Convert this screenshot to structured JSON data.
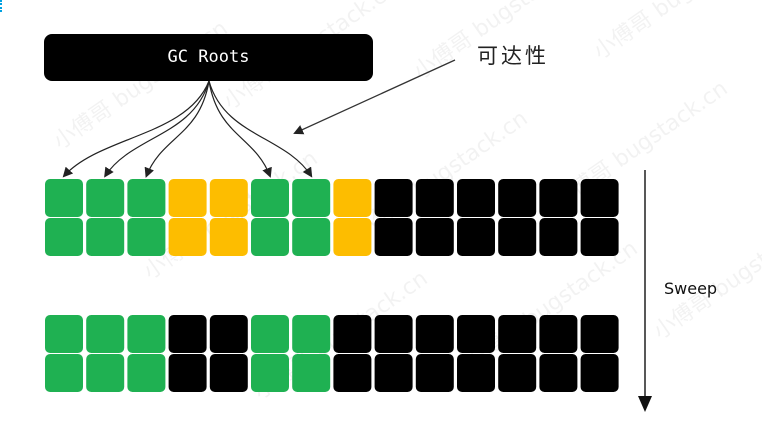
{
  "gc_roots_label": "GC Roots",
  "reachability_label": "可达性",
  "sweep_label": "Sweep",
  "watermark_text": "小傅哥 bugstack.cn",
  "colors": {
    "reachable": "#1fb152",
    "marked": "#fdbd00",
    "unreachable": "#000000",
    "root_box": "#000000"
  },
  "before_sweep": {
    "rows": [
      [
        "reachable",
        "reachable",
        "reachable",
        "marked",
        "marked",
        "reachable",
        "reachable",
        "marked",
        "unreachable",
        "unreachable",
        "unreachable",
        "unreachable",
        "unreachable",
        "unreachable"
      ],
      [
        "reachable",
        "reachable",
        "reachable",
        "marked",
        "marked",
        "reachable",
        "reachable",
        "marked",
        "unreachable",
        "unreachable",
        "unreachable",
        "unreachable",
        "unreachable",
        "unreachable"
      ]
    ]
  },
  "after_sweep": {
    "rows": [
      [
        "reachable",
        "reachable",
        "reachable",
        "unreachable",
        "unreachable",
        "reachable",
        "reachable",
        "unreachable",
        "unreachable",
        "unreachable",
        "unreachable",
        "unreachable",
        "unreachable",
        "unreachable"
      ],
      [
        "reachable",
        "reachable",
        "reachable",
        "unreachable",
        "unreachable",
        "reachable",
        "reachable",
        "unreachable",
        "unreachable",
        "unreachable",
        "unreachable",
        "unreachable",
        "unreachable",
        "unreachable"
      ]
    ]
  },
  "root_arrow_targets": [
    1,
    2,
    3,
    6,
    7
  ]
}
